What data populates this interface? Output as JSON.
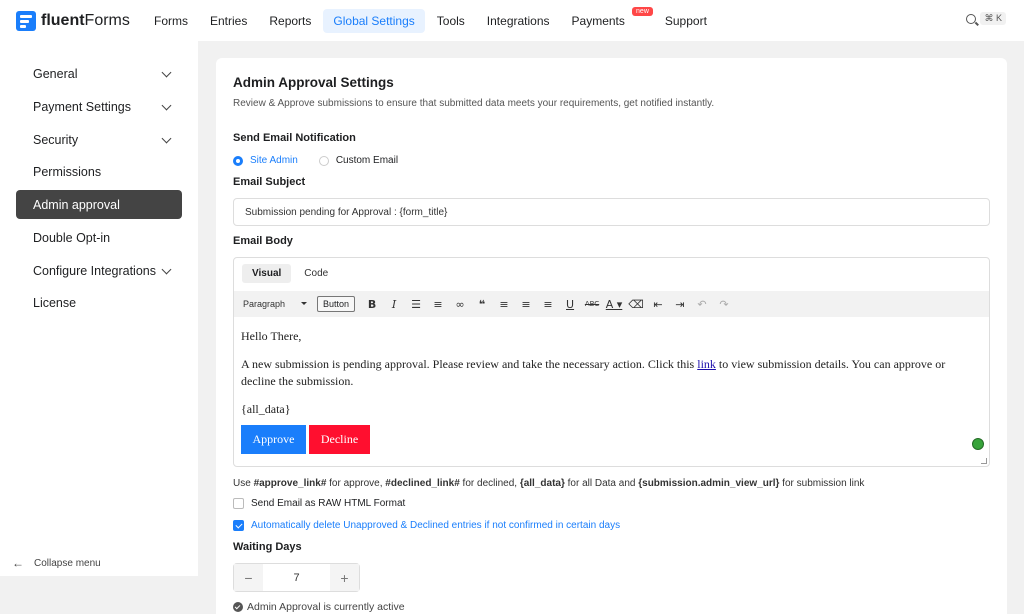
{
  "brand": {
    "name_bold": "fluent",
    "name_rest": "Forms"
  },
  "nav": {
    "items": [
      "Forms",
      "Entries",
      "Reports",
      "Global Settings",
      "Tools",
      "Integrations",
      "Payments",
      "Support"
    ],
    "payments_badge": "new",
    "shortcut": "⌘ K"
  },
  "sidebar": {
    "items": [
      {
        "label": "General"
      },
      {
        "label": "Payment Settings"
      },
      {
        "label": "Security"
      },
      {
        "label": "Permissions"
      },
      {
        "label": "Admin approval"
      },
      {
        "label": "Double Opt-in"
      },
      {
        "label": "Configure Integrations"
      },
      {
        "label": "License"
      }
    ],
    "collapse_label": "Collapse menu"
  },
  "page": {
    "title": "Admin Approval Settings",
    "description": "Review & Approve submissions to ensure that submitted data meets your requirements, get notified instantly.",
    "send_email_label": "Send Email Notification",
    "radio_site_admin": "Site Admin",
    "radio_custom_email": "Custom Email",
    "email_subject_label": "Email Subject",
    "email_subject_value": "Submission pending for Approval : {form_title}",
    "email_body_label": "Email Body"
  },
  "editor": {
    "tab_visual": "Visual",
    "tab_code": "Code",
    "format_value": "Paragraph",
    "button_label": "Button",
    "line1": "Hello There,",
    "line2_before": "A new submission is pending approval. Please review and take the necessary action. Click this ",
    "line2_link": "link",
    "line2_after": " to view submission details. You can approve or decline the submission.",
    "line3": "{all_data}",
    "approve_label": "Approve",
    "decline_label": "Decline"
  },
  "help": {
    "prefix": "Use ",
    "approve_tag": "#approve_link#",
    "approve_text": " for approve, ",
    "declined_tag": "#declined_link#",
    "declined_text": " for declined, ",
    "all_data_tag": "{all_data}",
    "all_data_text": " for all Data and ",
    "admin_url_tag": "{submission.admin_view_url}",
    "admin_url_text": " for submission link"
  },
  "options": {
    "raw_html_label": "Send Email as RAW HTML Format",
    "auto_delete_label": "Automatically delete Unapproved & Declined entries if not confirmed in certain days",
    "waiting_days_label": "Waiting Days",
    "waiting_days_value": "7",
    "status_text": "Admin Approval is currently active"
  },
  "colors": {
    "accent": "#1a7efb",
    "decline": "#ff0f2f",
    "sidebar_active": "#444444"
  }
}
